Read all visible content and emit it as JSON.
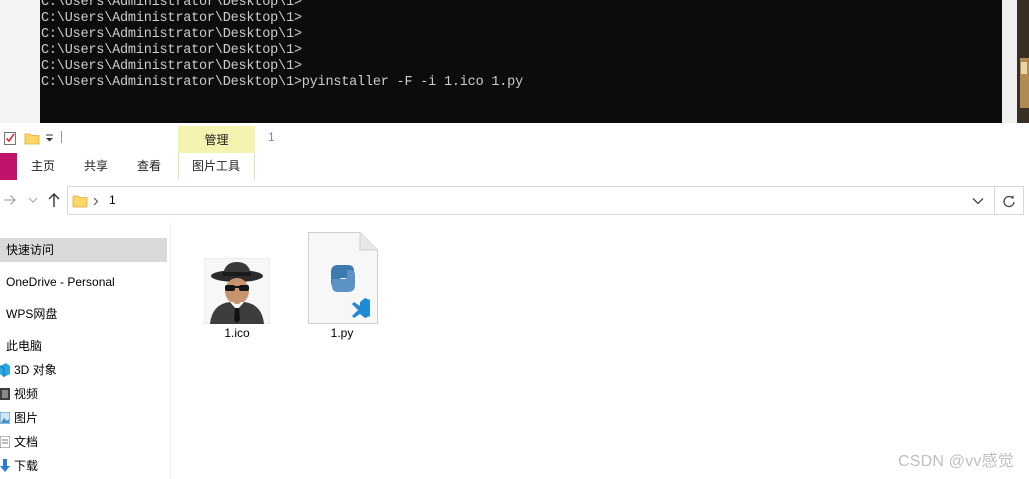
{
  "console": {
    "lines": [
      "C:\\Users\\Administrator\\Desktop\\1>",
      "C:\\Users\\Administrator\\Desktop\\1>",
      "C:\\Users\\Administrator\\Desktop\\1>",
      "C:\\Users\\Administrator\\Desktop\\1>",
      "C:\\Users\\Administrator\\Desktop\\1>",
      "C:\\Users\\Administrator\\Desktop\\1>pyinstaller -F -i 1.ico 1.py"
    ]
  },
  "explorer": {
    "window_title": "1",
    "contextual_tab": "管理",
    "tabs": [
      "主页",
      "共享",
      "查看",
      "图片工具"
    ],
    "address": {
      "folder": "1"
    },
    "nav": [
      {
        "label": "快速访问",
        "icon": "star-icon",
        "selected": true
      },
      {
        "label": "OneDrive - Personal",
        "icon": "cloud-icon",
        "selected": false
      },
      {
        "label": "WPS网盘",
        "icon": "cloud-icon",
        "selected": false
      },
      {
        "label": "此电脑",
        "icon": "computer-icon",
        "selected": false
      },
      {
        "label": "3D 对象",
        "icon": "cube-icon",
        "selected": false
      },
      {
        "label": "视频",
        "icon": "video-icon",
        "selected": false
      },
      {
        "label": "图片",
        "icon": "picture-icon",
        "selected": false
      },
      {
        "label": "文档",
        "icon": "document-icon",
        "selected": false
      },
      {
        "label": "下载",
        "icon": "download-icon",
        "selected": false
      }
    ],
    "files": [
      {
        "name": "1.ico",
        "icon": "spy-icon"
      },
      {
        "name": "1.py",
        "icon": "python-file-icon"
      }
    ]
  },
  "watermark": "CSDN @vv感觉",
  "colors": {
    "console_bg": "#0c0c0c",
    "console_text": "#cccccc",
    "contextual_tab_bg": "#f4f3b0",
    "selected_nav_bg": "#d9d9d9",
    "file_tab": "#c0146c"
  }
}
